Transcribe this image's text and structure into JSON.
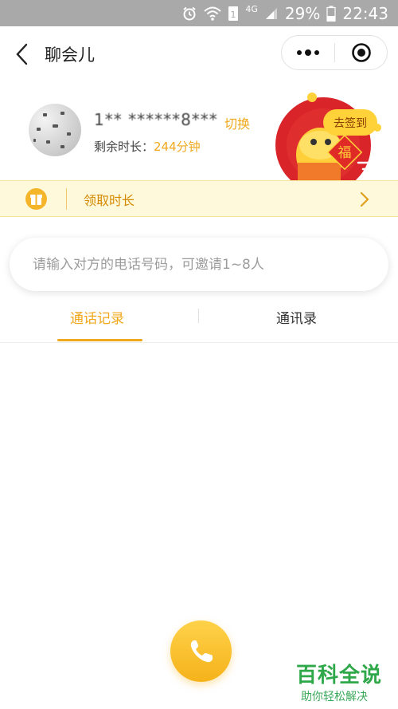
{
  "status_bar": {
    "network": "4G",
    "battery_percent": "29%",
    "time": "22:43"
  },
  "nav": {
    "title": "聊会儿"
  },
  "profile": {
    "phone_masked": "1**  ******8***",
    "switch_label": "切换",
    "remaining_label": "剩余时长：",
    "remaining_value": "244分钟",
    "signin_label": "去签到",
    "fu_char": "福"
  },
  "claim": {
    "label": "领取时长"
  },
  "search": {
    "placeholder": "请输入对方的电话号码，可邀请1~8人",
    "value": ""
  },
  "tabs": {
    "items": [
      {
        "label": "通话记录",
        "active": true
      },
      {
        "label": "通讯录",
        "active": false
      }
    ]
  },
  "watermark": {
    "title": "百科全说",
    "subtitle": "助你轻松解决"
  },
  "colors": {
    "accent": "#f0a81c",
    "status_bar": "#a9a9a9",
    "claim_bg": "#fff9dc",
    "watermark_green": "#2fa84a"
  }
}
